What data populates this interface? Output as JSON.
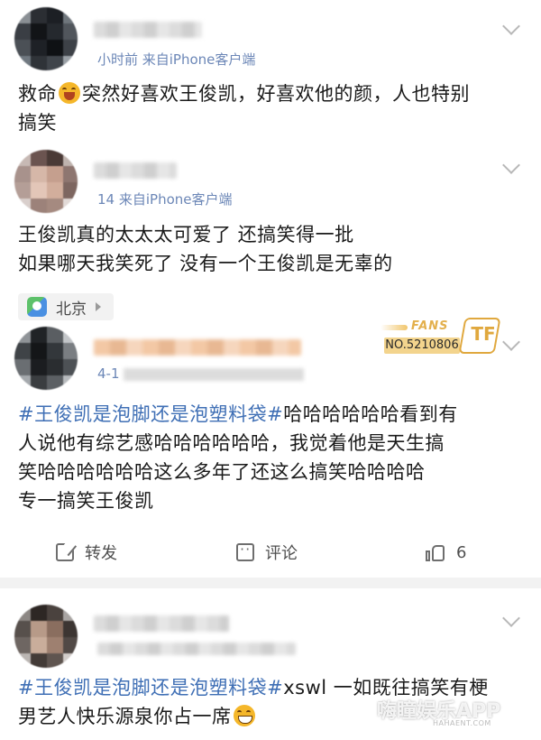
{
  "posts": [
    {
      "meta_source": "小时前  来自iPhone客户端",
      "text": [
        "救命",
        "突然好喜欢王俊凯，好喜欢他的颜，人也特别",
        "搞笑"
      ]
    },
    {
      "meta_source": "14  来自iPhone客户端",
      "text": [
        "王俊凯真的太太太可爱了 还搞笑得一批",
        "如果哪天我笑死了 没有一个王俊凯是无辜的"
      ],
      "location": "北京"
    },
    {
      "meta_source": "4-1",
      "badge": {
        "fans": "FANS",
        "number": "NO.5210806",
        "logo": "TF"
      },
      "hashtag": "#王俊凯是泡脚还是泡塑料袋#",
      "text": [
        "哈哈哈哈哈哈看到有",
        "人说他有综艺感哈哈哈哈哈哈，我觉着他是天生搞",
        "笑哈哈哈哈哈哈这么多年了还这么搞笑哈哈哈哈",
        "专一搞笑王俊凯"
      ],
      "actions": {
        "repost": "转发",
        "comment": "评论",
        "like_count": "6"
      }
    },
    {
      "hashtag": "#王俊凯是泡脚还是泡塑料袋#",
      "text": [
        "xswl 一如既往搞笑有梗",
        "男艺人快乐源泉你占一席"
      ]
    }
  ],
  "watermark": {
    "brand": "嗨瞳娱乐APP",
    "sub": "HAHAENT.COM"
  },
  "colors": {
    "link": "#3f6fb5",
    "meta": "#6c87b7",
    "separator": "#f2f2f2"
  }
}
